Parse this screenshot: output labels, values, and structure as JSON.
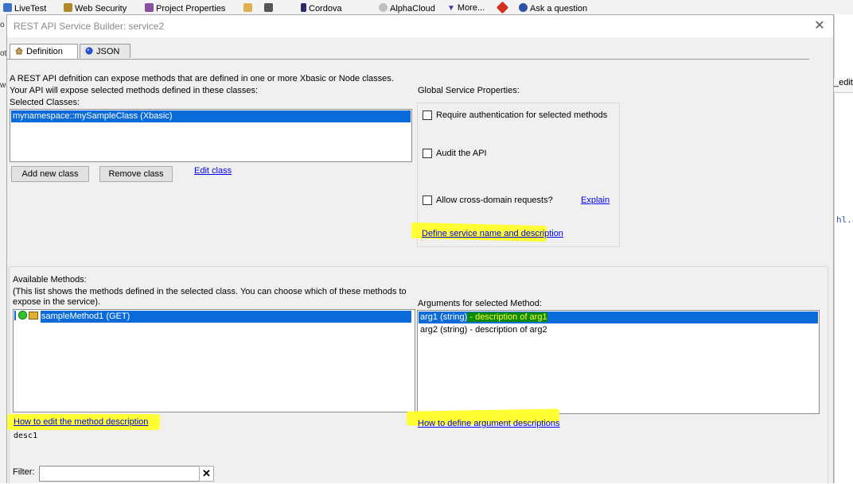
{
  "toolbar": {
    "items": [
      {
        "label": "LiveTest",
        "color": "#3a72c8"
      },
      {
        "label": "Web Security",
        "color": "#b08a2a"
      },
      {
        "label": "Project Properties",
        "color": "#8a4f9e"
      },
      {
        "label": "",
        "color": "#e0b050"
      },
      {
        "label": "",
        "color": "#555555"
      },
      {
        "label": "Cordova",
        "color": "#2a2a6a"
      },
      {
        "label": "AlphaCloud",
        "color": "#c0c0c0"
      },
      {
        "label": "More...",
        "color": "#3a3aa0"
      },
      {
        "label": "",
        "color": "#d03020"
      },
      {
        "label": "Ask a question",
        "color": "#2a52a8"
      }
    ]
  },
  "background": {
    "left_fragments": [
      "o",
      "ot",
      "ws"
    ],
    "right_fragments": [
      "_edit",
      "hl.a"
    ]
  },
  "dialog": {
    "title": "REST API Service Builder: service2",
    "tabs": [
      {
        "label": "Definition",
        "icon": "house-icon"
      },
      {
        "label": "JSON",
        "icon": "globe-icon"
      }
    ],
    "intro_line1": "A REST API defnition can expose methods that are defined in one or more Xbasic or Node classes.",
    "intro_line2": "Your API will expose selected methods defined in these classes:",
    "selected_classes_label": "Selected Classes:",
    "selected_classes": [
      "mynamespace::mySampleClass (Xbasic)"
    ],
    "add_class_label": "Add new class",
    "remove_class_label": "Remove class",
    "edit_class_label": "Edit class",
    "global_label": "Global Service Properties:",
    "require_auth_label": "Require authentication for selected methods",
    "audit_label": "Audit the API",
    "cross_domain_label": "Allow cross-domain requests?",
    "explain_label": "Explain",
    "define_service_label": "Define service name and description",
    "available_methods_label": "Available Methods:",
    "methods_note_line1": "(This list shows the methods defined in the selected class. You can choose which of these methods to",
    "methods_note_line2": "expose in the service).",
    "methods": [
      "sampleMethod1 (GET)"
    ],
    "arguments_label": "Arguments for selected Method:",
    "arguments": [
      {
        "name": "arg1 (string)",
        "desc": " - description of arg1"
      },
      {
        "name": "arg2 (string)",
        "desc": " - description of arg2"
      }
    ],
    "how_edit_method_label": "How to edit the method description",
    "method_desc_value": "desc1",
    "how_define_args_label": "How to define argument descriptions",
    "filter_label": "Filter:",
    "filter_value": "",
    "highlight_color": "#ffff33",
    "selection_color": "#0a6ad8"
  }
}
